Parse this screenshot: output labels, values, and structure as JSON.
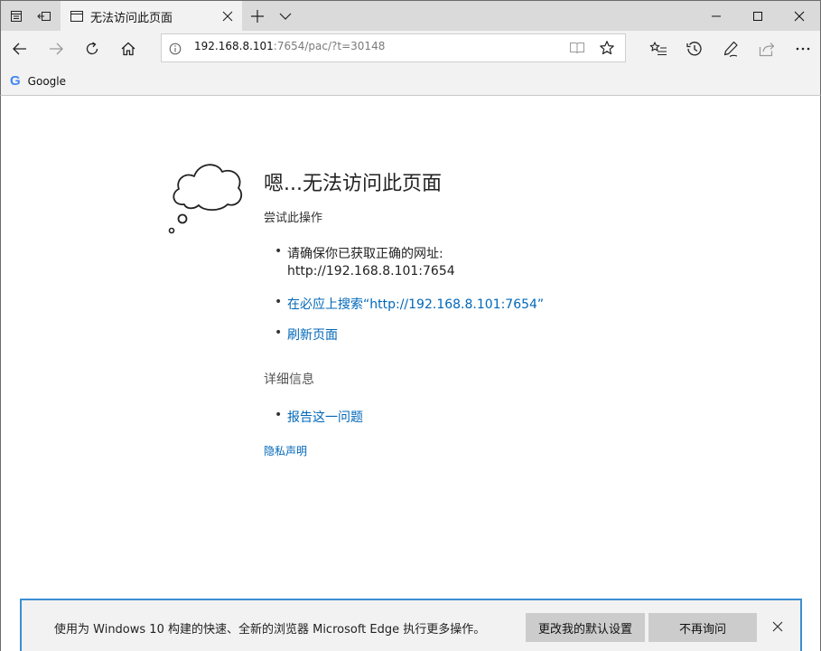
{
  "tab": {
    "title": "无法访问此页面"
  },
  "address": {
    "host": "192.168.8.101",
    "path": ":7654/pac/?t=30148"
  },
  "favorites": [
    {
      "label": "Google",
      "icon": "google-icon"
    }
  ],
  "error": {
    "heading": "嗯...无法访问此页面",
    "try_label": "尝试此操作",
    "check_address_line1": "请确保你已获取正确的网址:",
    "check_address_line2": "http://192.168.8.101:7654",
    "search_link": "在必应上搜索“http://192.168.8.101:7654”",
    "refresh_link": "刷新页面",
    "details_label": "详细信息",
    "report_link": "报告这一问题",
    "privacy_link": "隐私声明"
  },
  "notification": {
    "text": "使用为 Windows 10 构建的快速、全新的浏览器 Microsoft Edge 执行更多操作。",
    "default_button": "更改我的默认设置",
    "dismiss_button": "不再询问"
  },
  "colors": {
    "link": "#0067b8",
    "accent_border": "#3b8fd3",
    "chrome_bg": "#f2f2f2",
    "titlebar_bg": "#dadada"
  }
}
